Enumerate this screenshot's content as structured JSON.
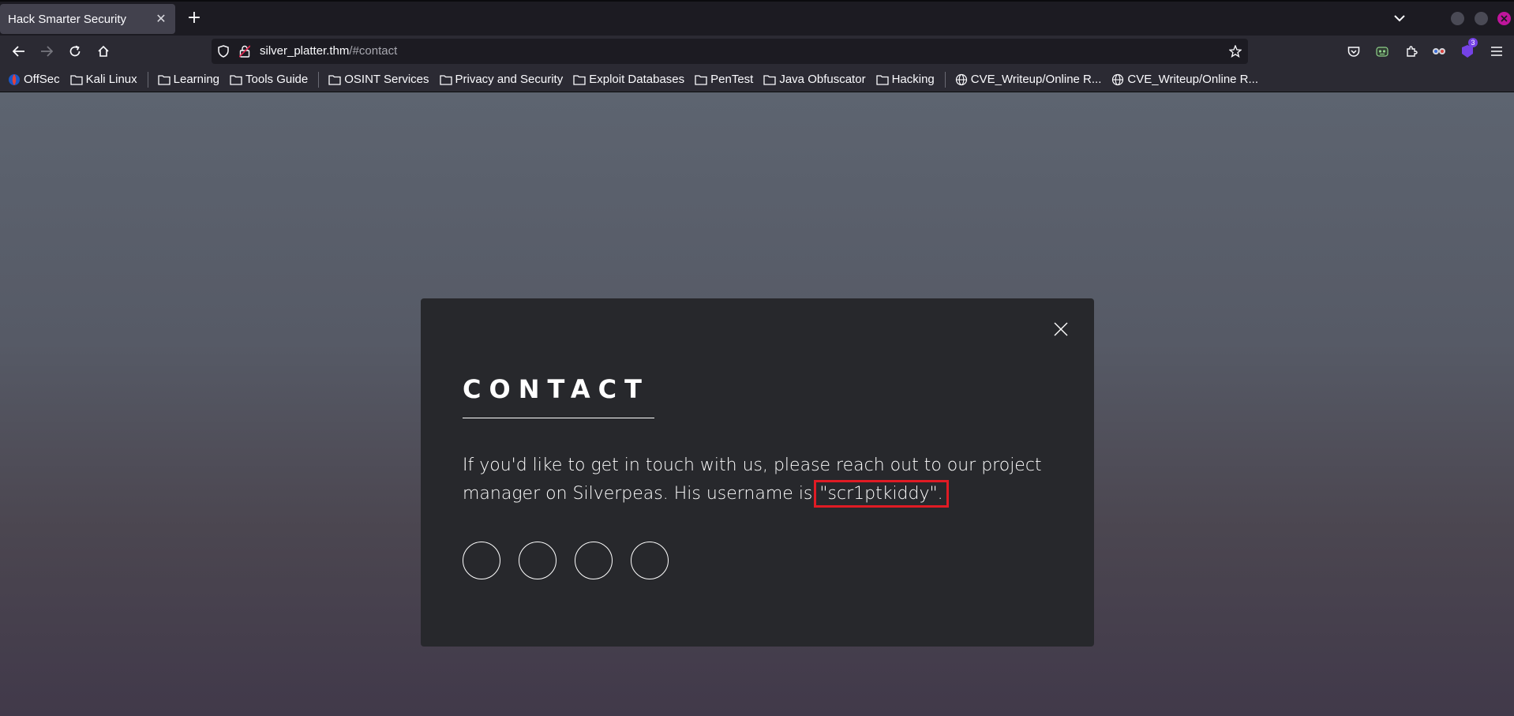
{
  "tab": {
    "title": "Hack Smarter Security",
    "close_symbol": "✕"
  },
  "new_tab_symbol": "+",
  "url": {
    "host": "silver_platter.thm",
    "path": "/#contact"
  },
  "extensions": {
    "badge_count": "3"
  },
  "bookmarks": [
    {
      "label": "OffSec",
      "icon": "offsec-icon"
    },
    {
      "label": "Kali Linux",
      "icon": "folder-icon"
    },
    {
      "label": "Learning",
      "icon": "folder-icon"
    },
    {
      "label": "Tools Guide",
      "icon": "folder-icon"
    },
    {
      "label": "OSINT Services",
      "icon": "folder-icon"
    },
    {
      "label": "Privacy and Security",
      "icon": "folder-icon"
    },
    {
      "label": "Exploit Databases",
      "icon": "folder-icon"
    },
    {
      "label": "PenTest",
      "icon": "folder-icon"
    },
    {
      "label": "Java Obfuscator",
      "icon": "folder-icon"
    },
    {
      "label": "Hacking",
      "icon": "folder-icon"
    },
    {
      "label": "CVE_Writeup/Online R...",
      "icon": "globe-icon"
    },
    {
      "label": "CVE_Writeup/Online R...",
      "icon": "globe-icon"
    }
  ],
  "modal": {
    "title": "CONTACT",
    "text_before": "If you'd like to get in touch with us, please reach out to our project manager on Silverpeas. His username is ",
    "username": "\"scr1ptkiddy\".",
    "close_symbol": "✕",
    "highlight_color": "#e01b24"
  },
  "colors": {
    "chrome_dark": "#1c1b22",
    "toolbar": "#2b2a33",
    "active_tab": "#42414d",
    "modal_bg": "#27282c",
    "close_button": "#c0159c"
  }
}
